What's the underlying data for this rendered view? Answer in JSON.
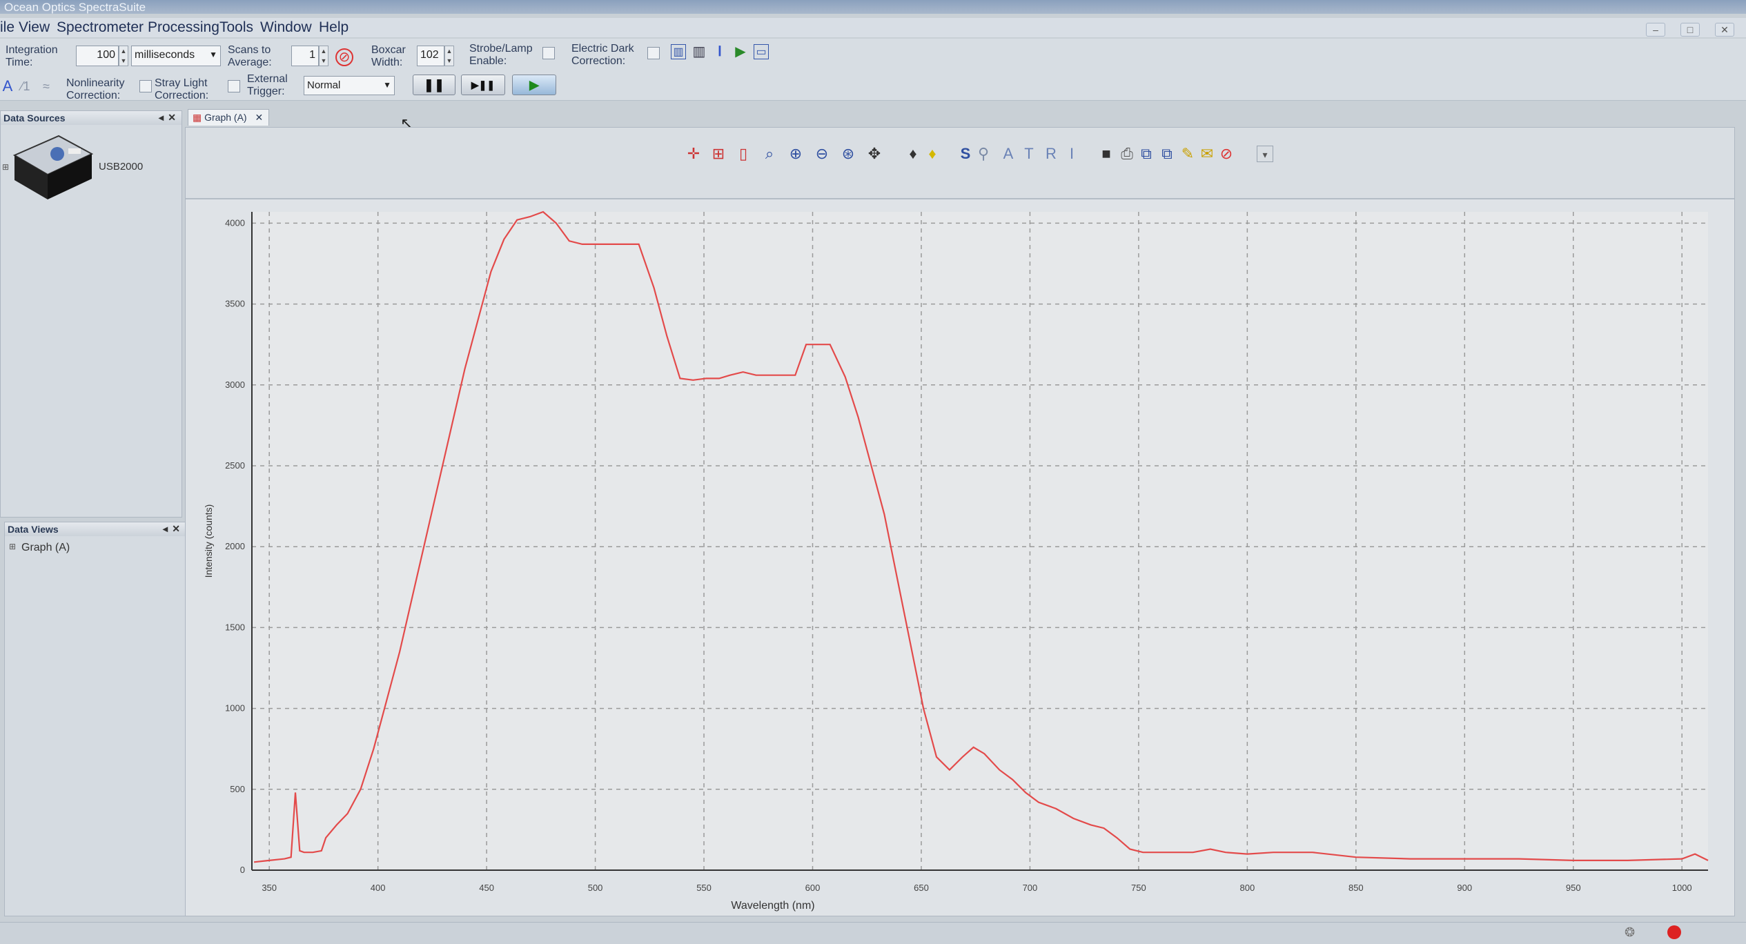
{
  "window": {
    "title": "Ocean Optics SpectraSuite",
    "minimize": "–",
    "maximize": "□",
    "close": "✕"
  },
  "menu": [
    "ile",
    "View",
    "Spectrometer",
    "Processing",
    "Tools",
    "Window",
    "Help"
  ],
  "toolbar": {
    "integration_time_label": "Integration Time:",
    "integration_time_value": "100",
    "integration_unit": "milliseconds",
    "scans_label": "Scans to Average:",
    "scans_value": "1",
    "boxcar_label": "Boxcar Width:",
    "boxcar_value": "102",
    "strobe_label": "Strobe/Lamp Enable:",
    "electric_dark_label": "Electric Dark Correction:",
    "nonlinearity_label": "Nonlinearity Correction:",
    "stray_light_label": "Stray Light Correction:",
    "external_trigger_label": "External Trigger:",
    "trigger_mode": "Normal",
    "pause_label": "❚❚",
    "single_label": "▶❚❚",
    "play_label": "▶"
  },
  "data_sources": {
    "title": "Data Sources",
    "device": "USB2000"
  },
  "data_views": {
    "title": "Data Views",
    "items": [
      "Graph (A)"
    ]
  },
  "graph_tab": {
    "label": "Graph (A)"
  },
  "graph_toolbar_letters": {
    "s": "S",
    "a1": "A",
    "t": "T",
    "r": "R",
    "i": "I"
  },
  "colors": {
    "line": "#e34a4a",
    "grid": "#9a9a9a",
    "plot_bg": "#e6e8ea"
  },
  "chart_data": {
    "type": "line",
    "xlabel": "Wavelength (nm)",
    "ylabel": "Intensity (counts)",
    "xlim": [
      342,
      1012
    ],
    "ylim": [
      0,
      4070
    ],
    "xticks": [
      350,
      400,
      450,
      500,
      550,
      600,
      650,
      700,
      750,
      800,
      850,
      900,
      950,
      1000
    ],
    "yticks": [
      0,
      500,
      1000,
      1500,
      2000,
      2500,
      3000,
      3500,
      4000
    ],
    "grid": true,
    "series": [
      {
        "x": [
          343,
          350,
          357,
          360,
          362,
          364,
          366,
          370,
          374,
          376,
          381,
          386,
          392,
          398,
          404,
          410,
          416,
          422,
          428,
          434,
          440,
          446,
          452,
          458,
          464,
          470,
          476,
          482,
          488,
          494,
          500,
          510,
          520,
          527,
          533,
          539,
          545,
          551,
          557,
          562,
          568,
          574,
          580,
          586,
          592,
          597,
          603,
          608,
          615,
          621,
          627,
          633,
          639,
          645,
          651,
          657,
          663,
          669,
          674,
          679,
          686,
          692,
          698,
          704,
          712,
          720,
          728,
          734,
          740,
          746,
          752,
          760,
          775,
          783,
          790,
          800,
          812,
          830,
          850,
          875,
          900,
          925,
          950,
          975,
          1000,
          1006,
          1012
        ],
        "y": [
          50,
          60,
          70,
          80,
          480,
          120,
          110,
          110,
          120,
          200,
          280,
          350,
          500,
          750,
          1050,
          1350,
          1700,
          2050,
          2400,
          2750,
          3100,
          3400,
          3700,
          3900,
          4020,
          4040,
          4070,
          4000,
          3890,
          3870,
          3870,
          3870,
          3870,
          3600,
          3300,
          3040,
          3030,
          3040,
          3040,
          3060,
          3080,
          3060,
          3060,
          3060,
          3060,
          3250,
          3250,
          3250,
          3050,
          2800,
          2500,
          2200,
          1800,
          1400,
          1000,
          700,
          620,
          700,
          760,
          720,
          620,
          560,
          480,
          420,
          380,
          320,
          280,
          260,
          200,
          130,
          110,
          110,
          110,
          130,
          110,
          100,
          110,
          110,
          80,
          70,
          70,
          70,
          60,
          60,
          70,
          100,
          60
        ]
      }
    ]
  }
}
